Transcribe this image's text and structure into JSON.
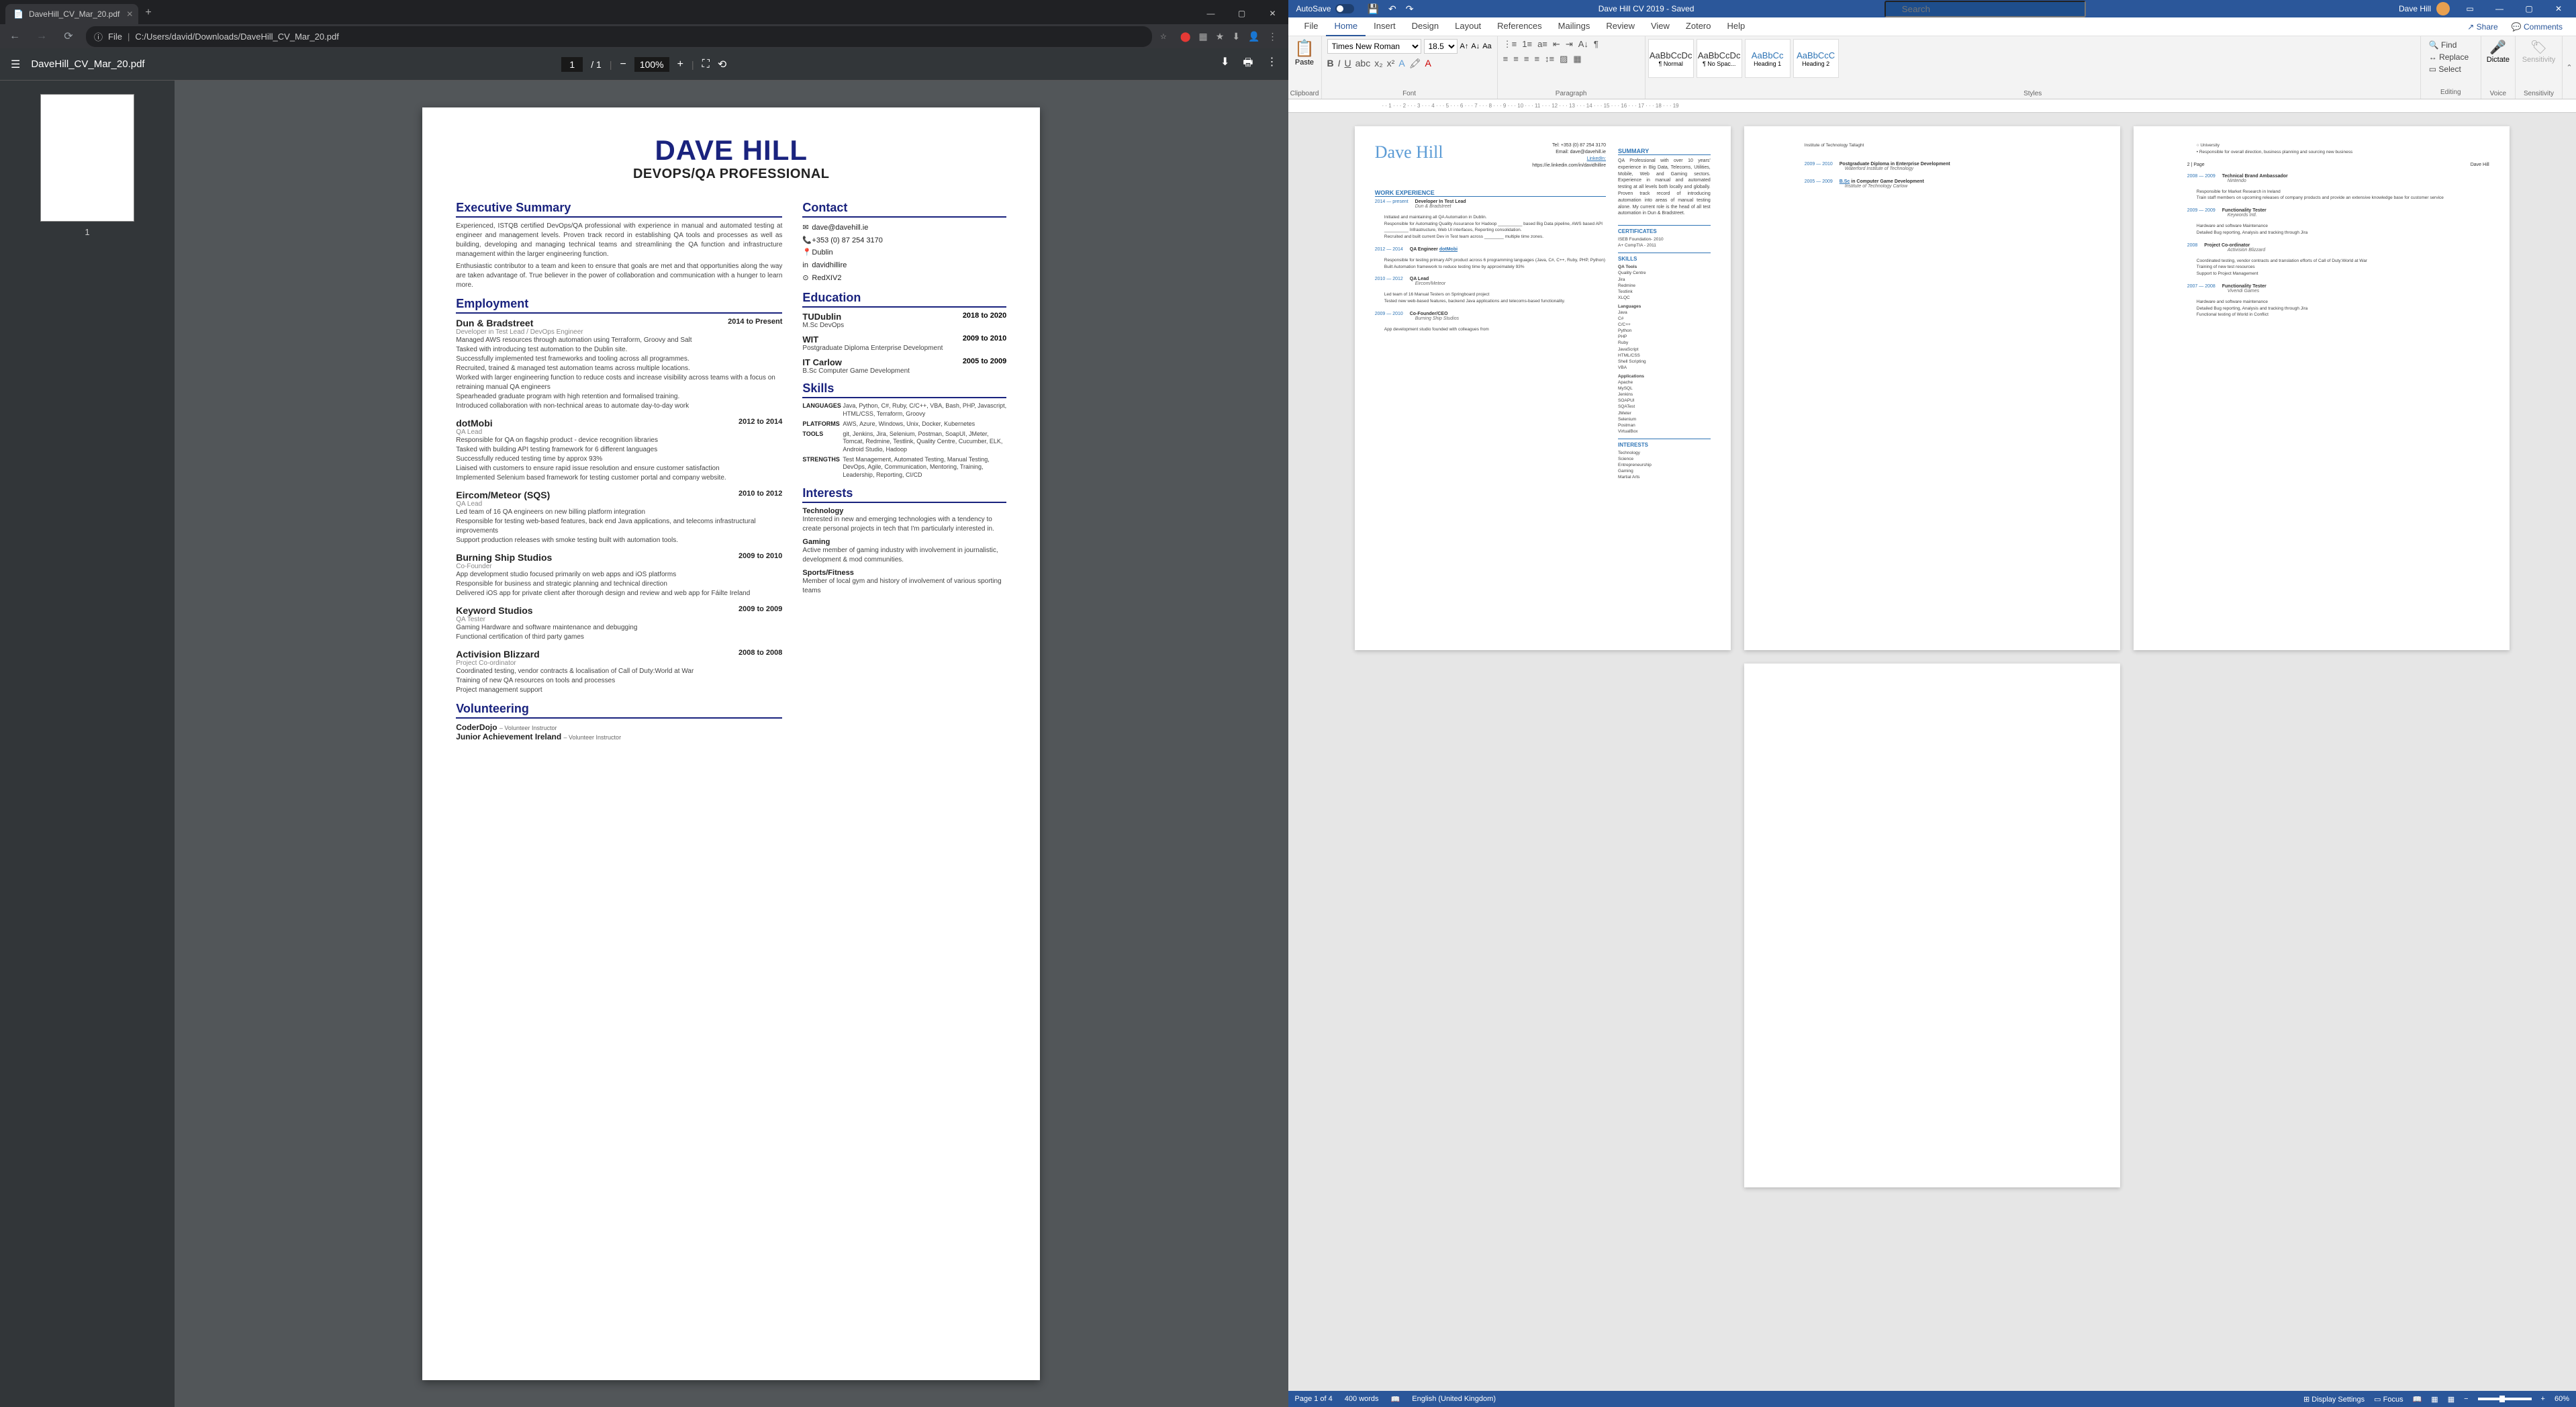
{
  "chrome": {
    "tab_title": "DaveHill_CV_Mar_20.pdf",
    "url_prefix": "File",
    "url": "C:/Users/david/Downloads/DaveHill_CV_Mar_20.pdf",
    "pdf_title": "DaveHill_CV_Mar_20.pdf",
    "page_current": "1",
    "page_total": "/ 1",
    "zoom": "100%",
    "thumb_label": "1"
  },
  "cv": {
    "name": "DAVE HILL",
    "subtitle": "DEVOPS/QA PROFESSIONAL",
    "headings": {
      "exec": "Executive Summary",
      "employ": "Employment",
      "volunteer": "Volunteering",
      "contact": "Contact",
      "education": "Education",
      "skills": "Skills",
      "interests": "Interests"
    },
    "exec1": "Experienced, ISTQB certified DevOps/QA professional with experience in manual and automated testing at engineer and management levels. Proven track record in establishing QA tools and processes as well as building, developing and managing technical teams and streamlining the QA function and infrastructure management within the larger engineering function.",
    "exec2": "Enthusiastic contributor to a team and keen to ensure that goals are met and that opportunities along the way are taken advantage of. True believer in the power of collaboration and communication with a hunger to learn more.",
    "jobs": [
      {
        "title": "Dun & Bradstreet",
        "role": "Developer in Test Lead / DevOps Engineer",
        "date": "2014 to Present",
        "bullets": "Managed AWS resources through automation using Terraform, Groovy and Salt\nTasked with introducing test automation to the Dublin site.\nSuccessfully implemented test frameworks and tooling across all programmes.\nRecruited, trained & managed test automation teams across multiple locations.\nWorked with larger engineering function to reduce costs and increase visibility across teams with a focus on retraining manual QA engineers\nSpearheaded graduate program with high retention and formalised training.\nIntroduced collaboration with non-technical areas to automate day-to-day work"
      },
      {
        "title": "dotMobi",
        "role": "QA Lead",
        "date": "2012 to 2014",
        "bullets": "Responsible for QA on flagship product - device recognition libraries\nTasked with building API testing framework for 6 different languages\nSuccessfully reduced testing time by approx 93%\nLiaised with customers to ensure rapid issue resolution and ensure customer satisfaction\nImplemented Selenium based framework for testing customer portal and company website."
      },
      {
        "title": "Eircom/Meteor (SQS)",
        "role": "QA Lead",
        "date": "2010 to 2012",
        "bullets": "Led team of 16 QA engineers on new billing platform integration\nResponsible for testing web-based features, back end Java applications, and telecoms infrastructural improvements\nSupport production releases with smoke testing built with automation tools."
      },
      {
        "title": "Burning Ship Studios",
        "role": "Co-Founder",
        "date": "2009 to 2010",
        "bullets": "App development studio focused primarily on web apps and iOS platforms\nResponsible for business and strategic planning and technical direction\nDelivered iOS app for private client after thorough design and review and web app for Fáilte Ireland"
      },
      {
        "title": "Keyword Studios",
        "role": "QA Tester",
        "date": "2009 to 2009",
        "bullets": "Gaming Hardware and software maintenance and debugging\nFunctional certification of third party games"
      },
      {
        "title": "Activision Blizzard",
        "role": "Project Co-ordinator",
        "date": "2008 to 2008",
        "bullets": "Coordinated testing, vendor contracts & localisation of Call of Duty:World at War\nTraining of new QA resources on tools and processes\nProject management support"
      }
    ],
    "vol": [
      {
        "org": "CoderDojo",
        "role": "– Volunteer Instructor"
      },
      {
        "org": "Junior Achievement Ireland",
        "role": "– Volunteer Instructor"
      }
    ],
    "contact": {
      "email": "dave@davehill.ie",
      "phone": "+353 (0) 87 254 3170",
      "loc": "Dublin",
      "linkedin": "davidhillire",
      "other": "RedXIV2"
    },
    "edu": [
      {
        "school": "TUDublin",
        "date": "2018 to 2020",
        "degree": "M.Sc DevOps"
      },
      {
        "school": "WIT",
        "date": "2009 to 2010",
        "degree": "Postgraduate Diploma Enterprise Development"
      },
      {
        "school": "IT Carlow",
        "date": "2005 to 2009",
        "degree": "B.Sc Computer Game Development"
      }
    ],
    "skills": [
      {
        "lbl": "LANGUAGES",
        "val": "Java, Python, C#, Ruby, C/C++, VBA, Bash, PHP, Javascript, HTML/CSS, Terraform, Groovy"
      },
      {
        "lbl": "PLATFORMS",
        "val": "AWS, Azure, Windows, Unix, Docker, Kubernetes"
      },
      {
        "lbl": "TOOLS",
        "val": "git, Jenkins, Jira, Selenium, Postman, SoapUI, JMeter, Tomcat, Redmine, Testlink, Quality Centre, Cucumber, ELK, Android Studio, Hadoop"
      },
      {
        "lbl": "STRENGTHS",
        "val": "Test Management, Automated Testing, Manual Testing, DevOps, Agile, Communication, Mentoring, Training, Leadership, Reporting, CI/CD"
      }
    ],
    "interests": [
      {
        "h": "Technology",
        "b": "Interested in new and emerging technologies with a tendency to create personal projects in tech that I'm particularly interested in."
      },
      {
        "h": "Gaming",
        "b": "Active member of gaming industry with involvement in journalistic, development & mod communities."
      },
      {
        "h": "Sports/Fitness",
        "b": "Member of local gym and history of involvement of various sporting teams"
      }
    ]
  },
  "word": {
    "autosave_label": "AutoSave",
    "doc_name": "Dave Hill CV 2019 - Saved",
    "search_placeholder": "Search",
    "username": "Dave Hill",
    "tabs": [
      "File",
      "Home",
      "Insert",
      "Design",
      "Layout",
      "References",
      "Mailings",
      "Review",
      "View",
      "Zotero",
      "Help"
    ],
    "share": "Share",
    "comments": "Comments",
    "paste": "Paste",
    "font_name": "Times New Roman",
    "font_size": "18.5",
    "styles": [
      {
        "p": "AaBbCcDc",
        "n": "¶ Normal"
      },
      {
        "p": "AaBbCcDc",
        "n": "¶ No Spac..."
      },
      {
        "p": "AaBbCc",
        "n": "Heading 1"
      },
      {
        "p": "AaBbCcC",
        "n": "Heading 2"
      }
    ],
    "find": "Find",
    "replace": "Replace",
    "select": "Select",
    "dictate": "Dictate",
    "sensitivity": "Sensitivity",
    "groups": {
      "clipboard": "Clipboard",
      "font": "Font",
      "paragraph": "Paragraph",
      "styles": "Styles",
      "editing": "Editing",
      "voice": "Voice",
      "sens": "Sensitivity"
    },
    "status": {
      "page": "Page 1 of 4",
      "words": "400 words",
      "lang": "English (United Kingdom)",
      "display": "Display Settings",
      "focus": "Focus",
      "zoom": "60%"
    },
    "page1": {
      "name": "Dave Hill",
      "tel": "Tel: +353 (0) 87 254 3170",
      "email": "Email: dave@davehill.ie",
      "linkedin_lbl": "LinkedIn:",
      "linkedin": "https://ie.linkedin.com/in/davidhillire",
      "summary_h": "SUMMARY",
      "summary": "QA Professional with over 10 years' experience in Big Data, Telecoms, Utilities, Mobile, Web and Gaming sectors. Experience in manual and automated testing at all levels both locally and globally. Proven track record of introducing automation into areas of manual testing alone. My current role is the head of all test automation in Dun & Bradstreet.",
      "work_h": "WORK EXPERIENCE",
      "j1_date": "2014 — present",
      "j1_role": "Developer In Test Lead",
      "j1_comp": "Dun & Bradstreet",
      "j1_b": "Initiated and maintaining all QA Automation in Dublin.\nResponsible for Automating Quality Assurance for Hadoop __________ based Big Data pipeline, AWS based API __________ Infrastructure, Web UI interfaces, Reporting consolidation.\nRecruited and built current Dev in Test team across ________ multiple time zones.",
      "j2_date": "2012 — 2014",
      "j2_role": "QA Engineer",
      "j2_comp": "dotMobi",
      "j2_b": "Responsible for testing primary API product across 6 programming languages (Java, C#, C++, Ruby, PHP, Python)\nBuilt Automation framework to reduce testing time by approximately 93%",
      "j3_date": "2010 — 2012",
      "j3_role": "QA Lead",
      "j3_comp": "Eircom/Meteor",
      "j3_b": "Led team of 16 Manual Testers on Springboard project\nTested new web-based features, backend Java applications and telecoms-based functionality.",
      "j4_date": "2009 — 2010",
      "j4_role": "Co-Founder/CEO",
      "j4_comp": "Burning Ship Studios",
      "j4_b": "App development studio founded with colleagues from",
      "cert_h": "CERTIFICATES",
      "cert": "ISEB Foundation- 2010\nA+ CompTIA - 2011",
      "skills_h": "SKILLS",
      "qa_tools": "QA Tools",
      "qa_list": "Quality Centre\nJira\nRedmine\nTestlink\nXLQC",
      "lang_h": "Languages",
      "lang_list": "Java\nC#\nC/C++\nPython\nPHP\nRuby\nJavaScript\nHTML/CSS\nShell Scripting\nVBA",
      "apps_h": "Applications",
      "apps_list": "Apache\nMySQL\nJenkins\nSOAPUI\nSQATest\nJMeter\nSelenium\nPostman\nVirtualBox",
      "int_h": "INTERESTS",
      "int_list": "Technology\nScience\nEntrepreneurship\nGaming\nMartial Arts"
    },
    "page2": {
      "uni": "University",
      "l1": "Responsible for overall direction, business planning and sourcing new business",
      "pg": "2 | Page",
      "name": "Dave Hill",
      "j5_date": "2008 — 2009",
      "j5_role": "Technical Brand Ambassador",
      "j5_comp": "Nintendo",
      "j5_b": "Responsible for Market Research in Ireland\nTrain staff members on upcoming releases of company products and provide an extensive knowledge base for customer service",
      "j6_date": "2009 — 2009",
      "j6_role": "Functionality Tester",
      "j6_comp": "Keywords Intl.",
      "j6_b": "Hardware and software Maintenance\nDetailed Bug reporting, Analysis and tracking through Jira",
      "j7_date": "2008",
      "j7_role": "Project Co-ordinator",
      "j7_comp": "Activision Blizzard",
      "j7_b": "Coordinated testing, vendor contracts and translation efforts of Call of Duty:World at War\nTraining of new test resources\nSupport to Project Management",
      "j8_date": "2007 — 2008",
      "j8_role": "Functionality Tester",
      "j8_comp": "Vivendi Games",
      "j8_b": "Hardware and software maintenance\nDetailed Bug reporting, Analysis and tracking through Jira\nFunctional testing of World in Conflict"
    },
    "page3": {
      "l1": "Institute of Technology Tallaght",
      "e1_date": "2009 — 2010",
      "e1_deg": "Postgraduate Diploma in Enterprise Development",
      "e1_sch": "Waterford Institute of Technology",
      "e2_date": "2005 — 2009",
      "e2_deg": "B.Sc in Computer Game Development",
      "e2_sch": "Institute of Technology Carlow"
    }
  }
}
